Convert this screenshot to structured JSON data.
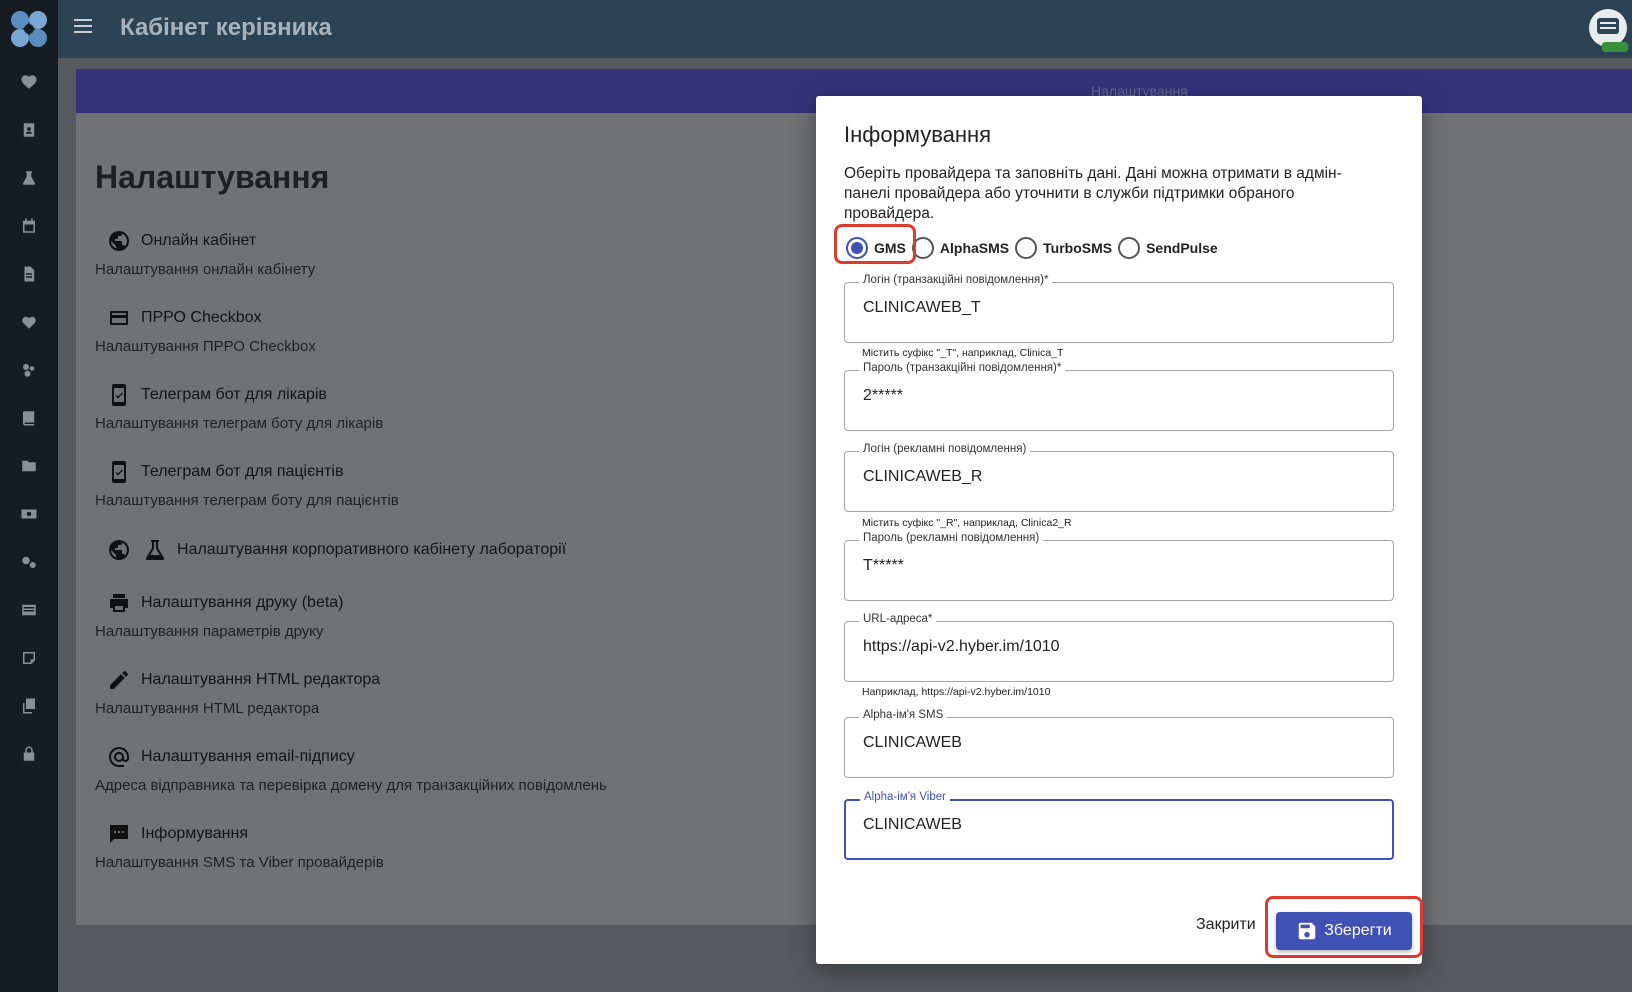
{
  "header": {
    "title": "Кабінет керівника"
  },
  "card": {
    "header_title": "Налаштування",
    "page_title": "Налаштування"
  },
  "settings": [
    {
      "icon": "globe-icon",
      "title": "Онлайн кабінет",
      "desc": "Налаштування онлайн кабінету"
    },
    {
      "icon": "credit-card-icon",
      "title": "ПРРО Checkbox",
      "desc": "Налаштування ПРРО Checkbox"
    },
    {
      "icon": "phone-check-icon",
      "title": "Телеграм бот для лікарів",
      "desc": "Налаштування телеграм боту для лікарів"
    },
    {
      "icon": "phone-check-icon",
      "title": "Телеграм бот для пацієнтів",
      "desc": "Налаштування телеграм боту для пацієнтів"
    },
    {
      "icon": "globe-flask-icon",
      "title": "Налаштування корпоративного кабінету лабораторії",
      "desc": ""
    },
    {
      "icon": "printer-icon",
      "title": "Налаштування друку (beta)",
      "desc": "Налаштування параметрів друку"
    },
    {
      "icon": "pencil-icon",
      "title": "Налаштування HTML редактора",
      "desc": "Налаштування HTML редактора"
    },
    {
      "icon": "at-sign-icon",
      "title": "Налаштування email-підпису",
      "desc": "Адреса відправника та перевірка домену для транзакційних повідомлень"
    },
    {
      "icon": "message-icon",
      "title": "Інформування",
      "desc": "Налаштування SMS та Viber провайдерів"
    }
  ],
  "modal": {
    "title": "Інформування",
    "text": "Оберіть провайдера та заповніть дані. Дані можна отримати в адмін-панелі провайдера або уточнити в служби підтримки обраного провайдера.",
    "providers": [
      {
        "label": "GMS",
        "selected": true
      },
      {
        "label": "AlphaSMS",
        "selected": false
      },
      {
        "label": "TurboSMS",
        "selected": false
      },
      {
        "label": "SendPulse",
        "selected": false
      }
    ],
    "fields": [
      {
        "label": "Логін (транзакційні повідомлення)*",
        "value": "CLINICAWEB_T",
        "help": "Містить суфікс \"_T\", наприклад, Clinica_T"
      },
      {
        "label": "Пароль (транзакційні повідомлення)*",
        "value": "2*****",
        "help": ""
      },
      {
        "label": "Логін (рекламні повідомлення)",
        "value": "CLINICAWEB_R",
        "help": "Містить суфікс \"_R\", наприклад, Clinica2_R"
      },
      {
        "label": "Пароль (рекламні повідомлення)",
        "value": "T*****",
        "help": ""
      },
      {
        "label": "URL-адреса*",
        "value": "https://api-v2.hyber.im/1010",
        "help": "Наприклад, https://api-v2.hyber.im/1010"
      },
      {
        "label": "Alpha-ім'я SMS",
        "value": "CLINICAWEB",
        "help": ""
      },
      {
        "label": "Alpha-ім'я Viber",
        "value": "CLINICAWEB",
        "help": ""
      }
    ],
    "close_label": "Закрити",
    "save_label": "Зберегти"
  },
  "colors": {
    "primary": "#3f51b5",
    "topbar": "#2b4355",
    "sidebar": "#161c21",
    "highlight": "#e03a2e"
  }
}
